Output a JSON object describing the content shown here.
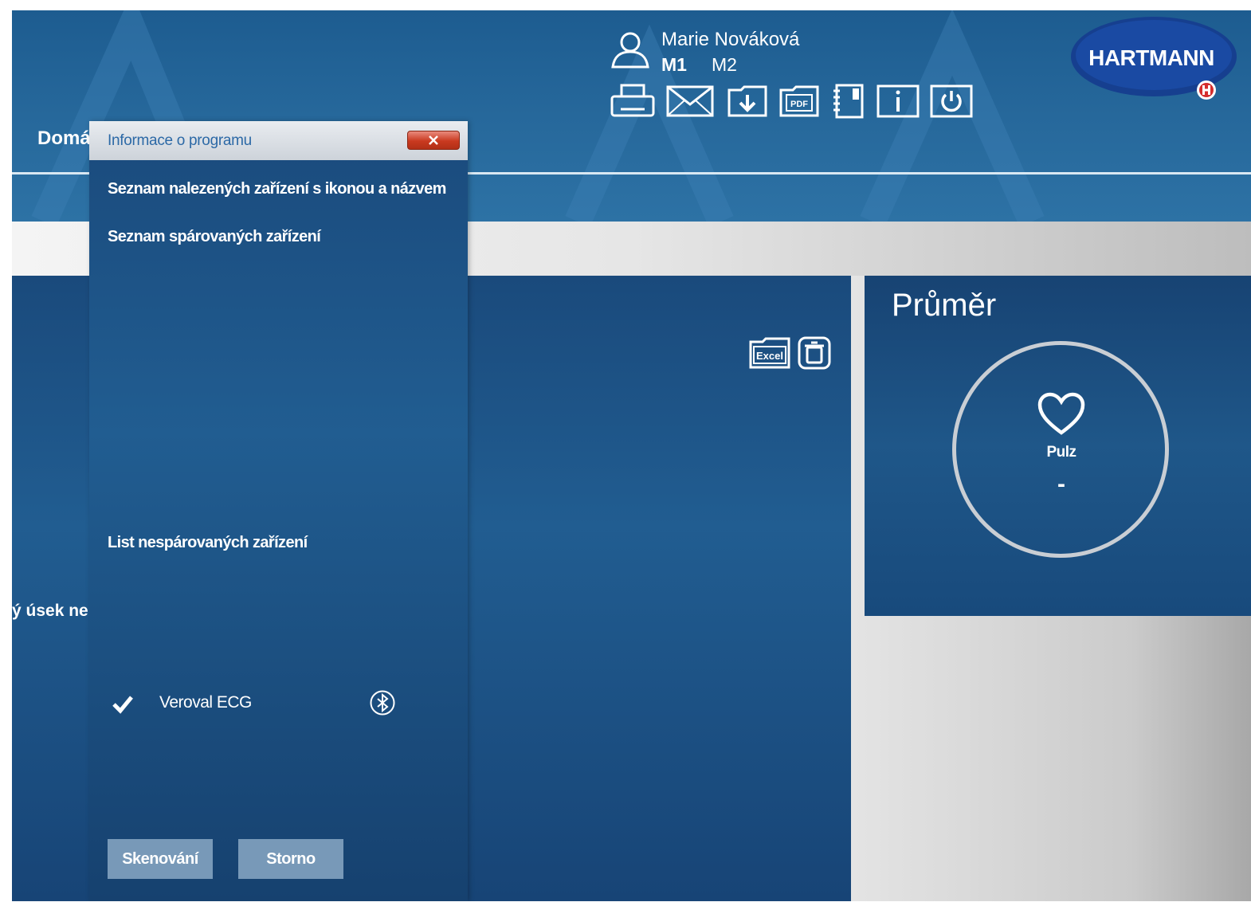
{
  "header": {
    "nav_home": "Domá",
    "user_name": "Marie Nováková",
    "memory_slots": [
      "M1",
      "M2"
    ],
    "toolbar_icons": [
      "printer-icon",
      "mail-icon",
      "download-icon",
      "pdf-icon",
      "notebook-icon",
      "info-icon",
      "power-icon"
    ],
    "pdf_label": "PDF",
    "logo_text": "HARTMANN"
  },
  "main": {
    "partial_text": "ý úsek ne",
    "excel_label": "Excel",
    "panel_icons": [
      "excel-export-icon",
      "trash-icon"
    ]
  },
  "average": {
    "title": "Průměr",
    "pulse_label": "Pulz",
    "pulse_value": "-"
  },
  "dialog": {
    "title": "Informace o programu",
    "found_devices_text": "Seznam nalezených zařízení s ikonou a názvem",
    "paired_devices_text": "Seznam spárovaných zařízení",
    "unpaired_heading": "List nespárovaných zařízení",
    "devices": [
      {
        "name": "Veroval ECG",
        "checked": true,
        "icon": "bluetooth-icon"
      }
    ],
    "buttons": {
      "scan": "Skenování",
      "cancel": "Storno"
    }
  },
  "colors": {
    "header_blue": "#27699c",
    "panel_blue": "#1f5789",
    "button_gray_blue": "#7899b8",
    "close_red": "#c9391f",
    "logo_blue": "#163f8f"
  }
}
